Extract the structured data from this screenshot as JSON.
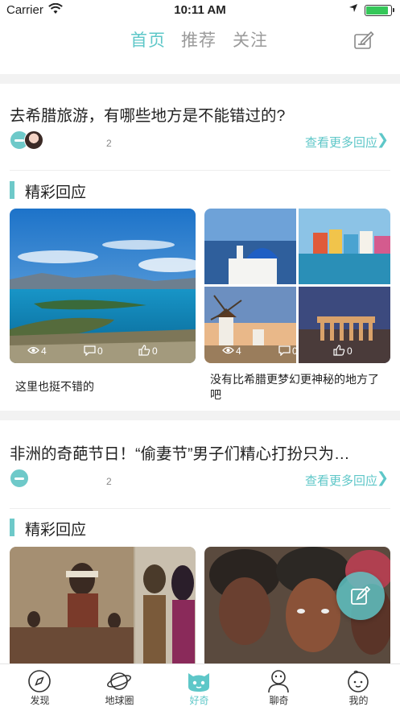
{
  "status_bar": {
    "carrier": "Carrier",
    "time": "10:11 AM"
  },
  "top_tabs": [
    {
      "label": "首页",
      "active": true
    },
    {
      "label": "推荐",
      "active": false
    },
    {
      "label": "关注",
      "active": false
    }
  ],
  "icons": {
    "edit": "edit-note-icon",
    "fab": "compose-icon"
  },
  "colors": {
    "accent": "#5ec7c8",
    "section_bar": "#6ec9c9"
  },
  "posts": [
    {
      "title": "去希腊旅游，有哪些地方是不能错过的?",
      "answer_count": "2",
      "more_label": "查看更多回应",
      "section_label": "精彩回应",
      "cards": [
        {
          "views": "4",
          "comments": "0",
          "likes": "0",
          "caption": "这里也挺不错的"
        },
        {
          "views": "4",
          "comments": "0",
          "likes": "0",
          "caption": "没有比希腊更梦幻更神秘的地方了吧"
        }
      ]
    },
    {
      "title": "非洲的奇葩节日！“偷妻节”男子们精心打扮只为…",
      "answer_count": "2",
      "more_label": "查看更多回应",
      "section_label": "精彩回应"
    }
  ],
  "bottom_nav": [
    {
      "label": "发现",
      "icon": "compass-icon",
      "active": false
    },
    {
      "label": "地球圈",
      "icon": "planet-icon",
      "active": false
    },
    {
      "label": "好奇",
      "icon": "cat-face-icon",
      "active": true
    },
    {
      "label": "聊奇",
      "icon": "chat-person-icon",
      "active": false
    },
    {
      "label": "我的",
      "icon": "profile-face-icon",
      "active": false
    }
  ]
}
